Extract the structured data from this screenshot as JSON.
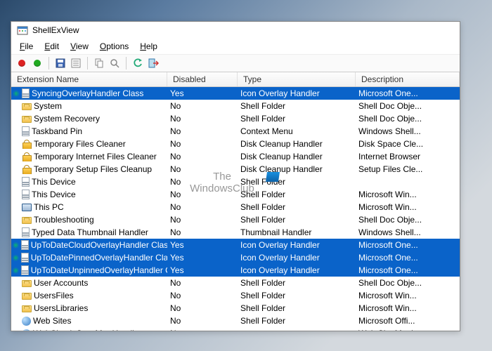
{
  "window": {
    "title": "ShellExView"
  },
  "menu": {
    "file": "File",
    "edit": "Edit",
    "view": "View",
    "options": "Options",
    "help": "Help"
  },
  "columns": [
    "Extension Name",
    "Disabled",
    "Type",
    "Description"
  ],
  "watermark": {
    "line1": "The",
    "line2": "WindowsClub"
  },
  "rows": [
    {
      "mark": true,
      "icon": "page",
      "name": "SyncingOverlayHandler Class",
      "disabled": "Yes",
      "type": "Icon Overlay Handler",
      "desc": "Microsoft One...",
      "sel": true
    },
    {
      "mark": false,
      "icon": "folder",
      "name": "System",
      "disabled": "No",
      "type": "Shell Folder",
      "desc": "Shell Doc Obje..."
    },
    {
      "mark": false,
      "icon": "folder",
      "name": "System Recovery",
      "disabled": "No",
      "type": "Shell Folder",
      "desc": "Shell Doc Obje..."
    },
    {
      "mark": false,
      "icon": "page",
      "name": "Taskband Pin",
      "disabled": "No",
      "type": "Context Menu",
      "desc": "Windows Shell..."
    },
    {
      "mark": false,
      "icon": "lock",
      "name": "Temporary Files Cleaner",
      "disabled": "No",
      "type": "Disk Cleanup Handler",
      "desc": "Disk Space Cle..."
    },
    {
      "mark": false,
      "icon": "lock",
      "name": "Temporary Internet Files Cleaner",
      "disabled": "No",
      "type": "Disk Cleanup Handler",
      "desc": "Internet Browser"
    },
    {
      "mark": false,
      "icon": "lock",
      "name": "Temporary Setup Files Cleanup",
      "disabled": "No",
      "type": "Disk Cleanup Handler",
      "desc": "Setup Files Cle..."
    },
    {
      "mark": false,
      "icon": "page",
      "name": "This Device",
      "disabled": "No",
      "type": "Shell Folder",
      "desc": ""
    },
    {
      "mark": false,
      "icon": "page",
      "name": "This Device",
      "disabled": "No",
      "type": "Shell Folder",
      "desc": "Microsoft Win..."
    },
    {
      "mark": false,
      "icon": "pc",
      "name": "This PC",
      "disabled": "No",
      "type": "Shell Folder",
      "desc": "Microsoft Win..."
    },
    {
      "mark": false,
      "icon": "folder",
      "name": "Troubleshooting",
      "disabled": "No",
      "type": "Shell Folder",
      "desc": "Shell Doc Obje..."
    },
    {
      "mark": false,
      "icon": "page",
      "name": "Typed Data Thumbnail Handler",
      "disabled": "No",
      "type": "Thumbnail Handler",
      "desc": "Windows Shell..."
    },
    {
      "mark": true,
      "icon": "page",
      "name": "UpToDateCloudOverlayHandler Class",
      "disabled": "Yes",
      "type": "Icon Overlay Handler",
      "desc": "Microsoft One...",
      "sel": true
    },
    {
      "mark": true,
      "icon": "page",
      "name": "UpToDatePinnedOverlayHandler Class",
      "disabled": "Yes",
      "type": "Icon Overlay Handler",
      "desc": "Microsoft One...",
      "sel": true
    },
    {
      "mark": true,
      "icon": "page",
      "name": "UpToDateUnpinnedOverlayHandler Cl...",
      "disabled": "Yes",
      "type": "Icon Overlay Handler",
      "desc": "Microsoft One...",
      "sel": true
    },
    {
      "mark": false,
      "icon": "folder",
      "name": "User Accounts",
      "disabled": "No",
      "type": "Shell Folder",
      "desc": "Shell Doc Obje..."
    },
    {
      "mark": false,
      "icon": "folder",
      "name": "UsersFiles",
      "disabled": "No",
      "type": "Shell Folder",
      "desc": "Microsoft Win..."
    },
    {
      "mark": false,
      "icon": "folder",
      "name": "UsersLibraries",
      "disabled": "No",
      "type": "Shell Folder",
      "desc": "Microsoft Win..."
    },
    {
      "mark": false,
      "icon": "globe",
      "name": "Web Sites",
      "disabled": "No",
      "type": "Shell Folder",
      "desc": "Microsoft Offi..."
    },
    {
      "mark": false,
      "icon": "globe",
      "name": "WebCheck SyncMgr Handler",
      "disabled": "No",
      "type": "",
      "desc": "Web Site Moni..."
    }
  ]
}
